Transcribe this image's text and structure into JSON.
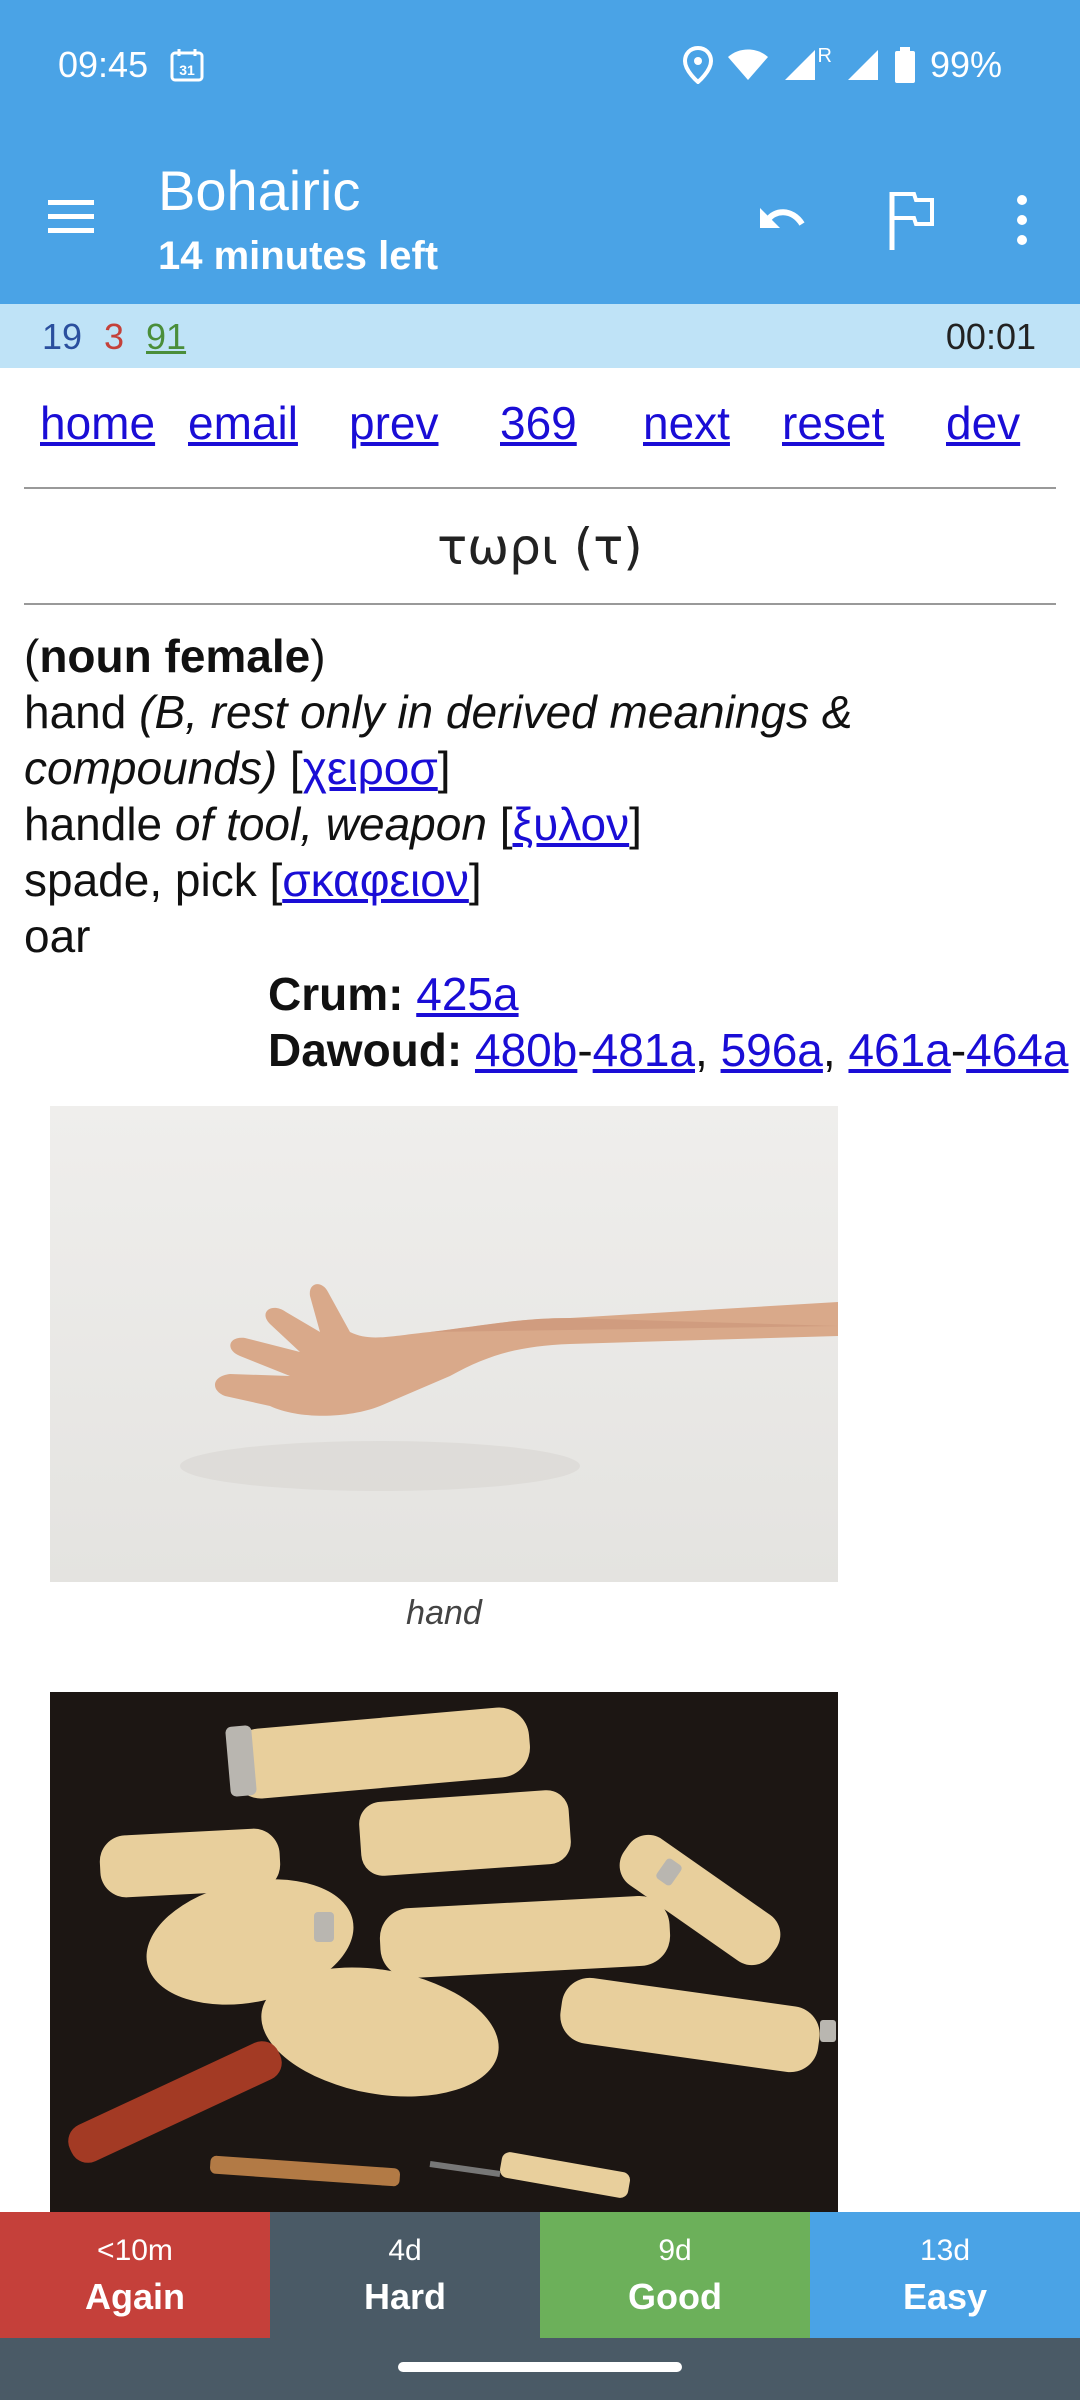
{
  "status_bar": {
    "time": "09:45",
    "calendar_day": "31",
    "roaming": "R",
    "battery": "99%"
  },
  "app_bar": {
    "title": "Bohairic",
    "subtitle": "14 minutes left"
  },
  "counts": {
    "new": "19",
    "learning": "3",
    "review": "91",
    "timer": "00:01"
  },
  "nav": {
    "home": "home",
    "email": "email",
    "prev": "prev",
    "number": "369",
    "next": "next",
    "reset": "reset",
    "dev": "dev"
  },
  "card": {
    "headword": "τωρι (τ)",
    "pos_open": "(",
    "pos": "noun female",
    "pos_close": ")",
    "sense1": "hand ",
    "sense1_note_a": "(B, rest only in derived meanings &",
    "sense1_note_b": "compounds)",
    "sense1_link": "χειροσ",
    "sense2": "handle ",
    "sense2_note": "of tool, weapon",
    "sense2_link": "ξυλον",
    "sense3": "spade, pick [",
    "sense3_link": "σκαφειον",
    "sense4": "oar",
    "crum_label": "Crum:",
    "crum_ref": "425a",
    "dawoud_label": "Dawoud:",
    "dawoud_refs": [
      "480b",
      "481a",
      "596a",
      "461a",
      "464a"
    ]
  },
  "images": {
    "caption1": "hand"
  },
  "answers": [
    {
      "interval": "<10m",
      "label": "Again"
    },
    {
      "interval": "4d",
      "label": "Hard"
    },
    {
      "interval": "9d",
      "label": "Good"
    },
    {
      "interval": "13d",
      "label": "Easy"
    }
  ],
  "colors": {
    "primary": "#4aa3e6",
    "again": "#c5403a",
    "hard": "#4a5a66",
    "good": "#6cb05a",
    "easy": "#4aa3e6",
    "link": "#1a0dd6"
  }
}
